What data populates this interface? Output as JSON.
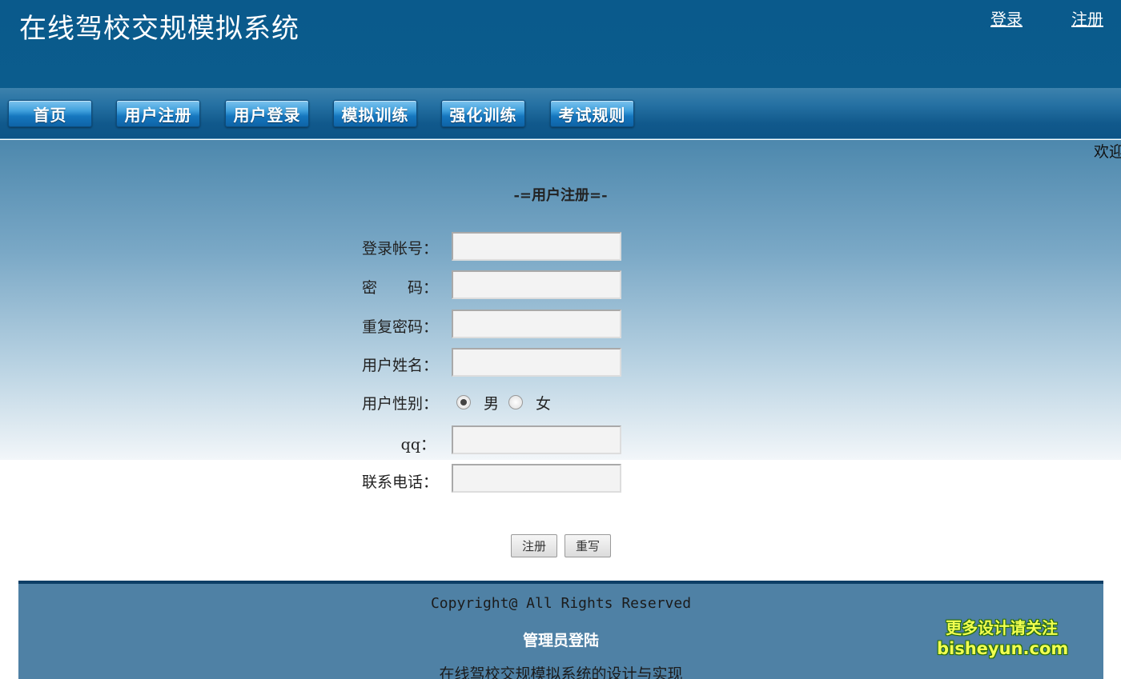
{
  "header": {
    "title": "在线驾校交规模拟系统",
    "login_link": "登录",
    "register_link": "注册"
  },
  "nav": {
    "items": [
      "首页",
      "用户注册",
      "用户登录",
      "模拟训练",
      "强化训练",
      "考试规则"
    ]
  },
  "welcome_text": "欢迎",
  "form": {
    "title": "-=用户注册=-",
    "fields": {
      "account": {
        "label": "登录帐号：",
        "value": ""
      },
      "password": {
        "label": "密　　码：",
        "value": ""
      },
      "password_repeat": {
        "label": "重复密码：",
        "value": ""
      },
      "name": {
        "label": "用户姓名：",
        "value": ""
      },
      "gender": {
        "label": "用户性别：",
        "options": [
          "男",
          "女"
        ],
        "selected": "男"
      },
      "qq": {
        "label": "qq：",
        "value": ""
      },
      "phone": {
        "label": "联系电话：",
        "value": ""
      }
    },
    "submit_label": "注册",
    "reset_label": "重写"
  },
  "footer": {
    "copyright": "Copyright@ All Rights Reserved",
    "admin_link": "管理员登陆",
    "system_name": "在线驾校交规模拟系统的设计与实现"
  },
  "watermark": {
    "line1": "更多设计请关注",
    "line2": "bisheyun.com"
  }
}
